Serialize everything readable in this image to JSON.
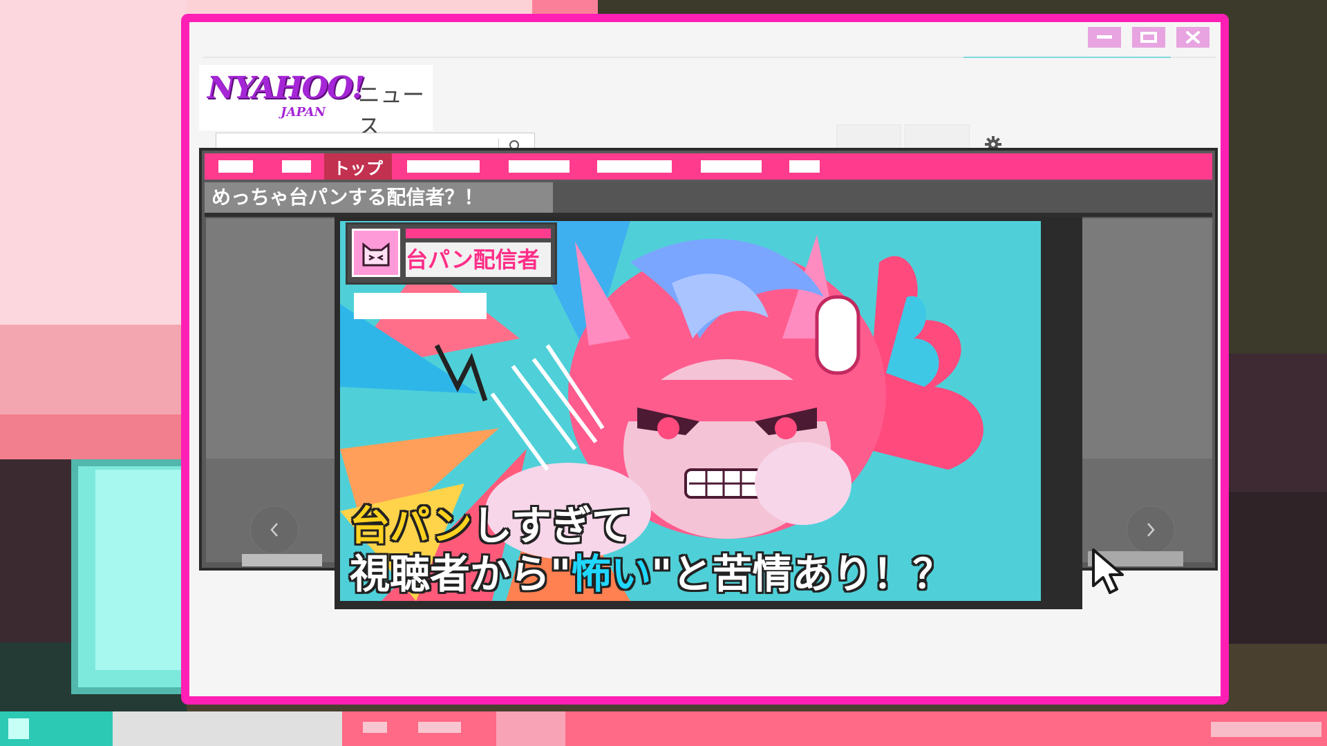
{
  "window": {
    "controls": {
      "minimize_icon": "minimize-icon",
      "maximize_icon": "maximize-icon",
      "close_icon": "close-icon"
    }
  },
  "header": {
    "logo_main": "NYAHOO!",
    "logo_sub": "JAPAN",
    "logo_section": "ニュース",
    "search": {
      "value": "",
      "placeholder": "",
      "icon": "search-icon"
    },
    "settings_icon": "gear-icon"
  },
  "nav": {
    "active_tab": "トップ"
  },
  "article": {
    "headline": "めっちゃ台パンする配信者？！",
    "streamer_label": "台パン配信者",
    "caption_line1_highlight": "台パン",
    "caption_line1_rest": "しすぎて",
    "caption_line2_pre": "視聴者から\"",
    "caption_line2_highlight": "怖い",
    "caption_line2_post": "\"と苦情あり！？",
    "prev_icon": "chevron-left-icon",
    "next_icon": "chevron-right-icon"
  },
  "colors": {
    "window_frame": "#ff1fb4",
    "nav_bar": "#ff3b8d",
    "nav_active": "#c2314f",
    "caption_yellow": "#ffd21f",
    "caption_cyan": "#20d7ff"
  }
}
